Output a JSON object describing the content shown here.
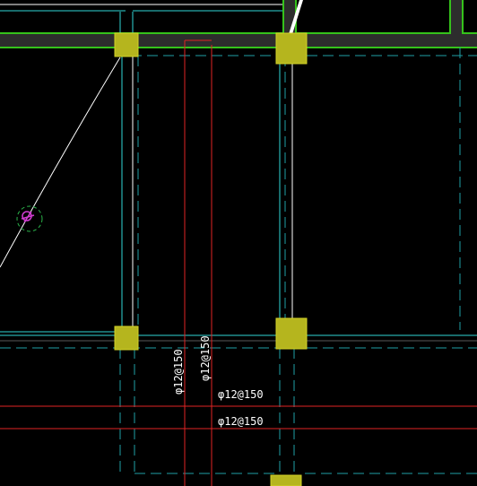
{
  "canvas": {
    "background_color": "#000000"
  },
  "colors": {
    "beam_edge": "#35c21b",
    "beam_fill": "#2d2d2d",
    "column_fill": "#b5b51e",
    "column_edge": "#d2d227",
    "wall_line": "#ffffff",
    "cyan_line": "#2fd6d6",
    "axis_dash": "#1f9fa6",
    "rebar_line": "#e02424",
    "hole_circle": "#2bb34a",
    "hole_mark": "#d23cd2",
    "label_text": "#ffffff"
  },
  "rebar_labels": {
    "vertical_left": "φ12@150",
    "vertical_right": "φ12@150",
    "horizontal_upper": "φ12@150",
    "horizontal_lower": "φ12@150"
  }
}
